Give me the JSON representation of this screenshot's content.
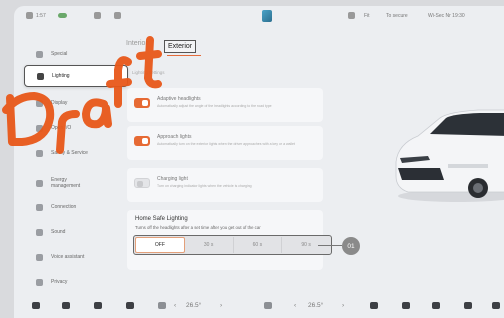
{
  "status_bar": {
    "time": "1:57",
    "right_items": [
      "Fit",
      "To secure",
      "Wi-Sec Nr 19:30"
    ]
  },
  "sidebar": {
    "items": [
      {
        "label": "Special",
        "active": false
      },
      {
        "label": "Lighting",
        "active": true
      },
      {
        "label": "Display",
        "active": false
      },
      {
        "label": "Open I/O",
        "active": false
      },
      {
        "label": "Safety & Service",
        "active": false
      },
      {
        "label": "Energy management",
        "active": false
      },
      {
        "label": "Connection",
        "active": false
      },
      {
        "label": "Sound",
        "active": false
      },
      {
        "label": "Voice assistant",
        "active": false
      },
      {
        "label": "Privacy",
        "active": false
      }
    ]
  },
  "tabs": [
    {
      "label": "Interior",
      "active": false
    },
    {
      "label": "Exterior",
      "active": true
    }
  ],
  "section_label": "Lighting settings",
  "settings": [
    {
      "title": "Adaptive headlights",
      "desc": "Automatically adjust the angle of the headlights according to the road type",
      "on": true
    },
    {
      "title": "Approach lights",
      "desc": "Automatically turn on the exterior lights when the driver approaches with a key or a wallet",
      "on": true
    },
    {
      "title": "Charging light",
      "desc": "Turn on charging indicator lights when the vehicle is charging",
      "on": false
    }
  ],
  "home_safe": {
    "title": "Home Safe Lighting",
    "description": "Turns off the headlights after a set time after you get out of the car",
    "options": [
      "OFF",
      "30 s",
      "60 s",
      "90 s"
    ],
    "selected": "OFF"
  },
  "callout": "01",
  "dock": {
    "left_temp": "26.5°",
    "right_temp": "26.5°"
  },
  "watermark_text": "Draft"
}
